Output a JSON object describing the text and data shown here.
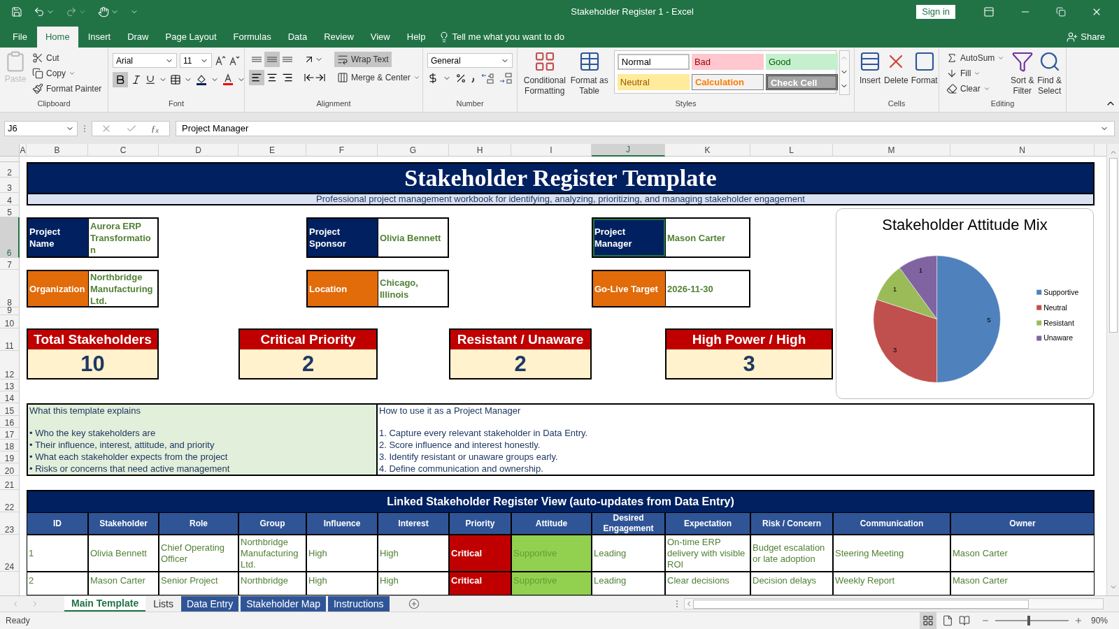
{
  "window": {
    "title": "Stakeholder Register 1  -  Excel",
    "sign_in": "Sign in"
  },
  "menu": {
    "tabs": [
      {
        "label": "File",
        "selected": false
      },
      {
        "label": "Home",
        "selected": true
      },
      {
        "label": "Insert",
        "selected": false
      },
      {
        "label": "Draw",
        "selected": false
      },
      {
        "label": "Page Layout",
        "selected": false
      },
      {
        "label": "Formulas",
        "selected": false
      },
      {
        "label": "Data",
        "selected": false
      },
      {
        "label": "Review",
        "selected": false
      },
      {
        "label": "View",
        "selected": false
      },
      {
        "label": "Help",
        "selected": false
      }
    ],
    "tell_me": "Tell me what you want to do",
    "share": "Share"
  },
  "ribbon": {
    "clipboard": {
      "paste": "Paste",
      "cut": "Cut",
      "copy": "Copy",
      "format_painter": "Format Painter",
      "label": "Clipboard"
    },
    "font": {
      "name": "Arial",
      "size": "11",
      "bold": true,
      "label": "Font"
    },
    "alignment": {
      "vertical_align": [
        {
          "selected": false
        },
        {
          "selected": true
        },
        {
          "selected": false
        }
      ],
      "horizontal_align": [
        {
          "selected": true
        },
        {
          "selected": false
        },
        {
          "selected": false
        }
      ],
      "wrap_text": true,
      "wrap_label": "Wrap Text",
      "merge_label": "Merge & Center",
      "label": "Alignment"
    },
    "number": {
      "format": "General",
      "label": "Number"
    },
    "styles": {
      "conditional": "Conditional Formatting",
      "format_table": "Format as Table",
      "label": "Styles",
      "gallery": [
        {
          "label": "Normal",
          "kind": "normal"
        },
        {
          "label": "Bad",
          "kind": "bad"
        },
        {
          "label": "Good",
          "kind": "good"
        },
        {
          "label": "Neutral",
          "kind": "neutral"
        },
        {
          "label": "Calculation",
          "kind": "calculation"
        },
        {
          "label": "Check Cell",
          "kind": "check"
        }
      ]
    },
    "cells": {
      "insert": "Insert",
      "delete": "Delete",
      "format": "Format",
      "label": "Cells"
    },
    "editing": {
      "autosum": "AutoSum",
      "fill": "Fill",
      "clear": "Clear",
      "sort": "Sort & Filter",
      "find": "Find & Select",
      "label": "Editing"
    }
  },
  "formula_bar": {
    "name_box": "J6",
    "function_label": "ƒ$_{x}$",
    "value": "Project Manager"
  },
  "columns": [
    {
      "label": "A",
      "selected": false
    },
    {
      "label": "B",
      "selected": false
    },
    {
      "label": "C",
      "selected": false
    },
    {
      "label": "D",
      "selected": false
    },
    {
      "label": "E",
      "selected": false
    },
    {
      "label": "F",
      "selected": false
    },
    {
      "label": "G",
      "selected": false
    },
    {
      "label": "H",
      "selected": false
    },
    {
      "label": "I",
      "selected": false
    },
    {
      "label": "J",
      "selected": true
    },
    {
      "label": "K",
      "selected": false
    },
    {
      "label": "L",
      "selected": false
    },
    {
      "label": "M",
      "selected": false
    },
    {
      "label": "N",
      "selected": false
    }
  ],
  "rows": [
    {
      "label": "2",
      "selected": false
    },
    {
      "label": "3",
      "selected": false
    },
    {
      "label": "4",
      "selected": false
    },
    {
      "label": "5",
      "selected": false
    },
    {
      "label": "6",
      "selected": true
    },
    {
      "label": "7",
      "selected": false
    },
    {
      "label": "8",
      "selected": false
    },
    {
      "label": "9",
      "selected": false
    },
    {
      "label": "10",
      "selected": false
    },
    {
      "label": "11",
      "selected": false
    },
    {
      "label": "12",
      "selected": false
    },
    {
      "label": "13",
      "selected": false
    },
    {
      "label": "14",
      "selected": false
    },
    {
      "label": "15",
      "selected": false
    },
    {
      "label": "16",
      "selected": false
    },
    {
      "label": "17",
      "selected": false
    },
    {
      "label": "18",
      "selected": false
    },
    {
      "label": "19",
      "selected": false
    },
    {
      "label": "20",
      "selected": false
    },
    {
      "label": "21",
      "selected": false
    },
    {
      "label": "22",
      "selected": false
    },
    {
      "label": "23",
      "selected": false
    },
    {
      "label": "24",
      "selected": false
    }
  ],
  "sheet": {
    "title": "Stakeholder Register Template",
    "subtitle": "Professional project management workbook for identifying, analyzing, prioritizing, and managing stakeholder engagement",
    "info": [
      {
        "label": "Project Name",
        "value": "Aurora ERP Transformation",
        "color": "#002060",
        "selected": false
      },
      {
        "label": "Project Sponsor",
        "value": "Olivia Bennett",
        "color": "#002060",
        "selected": false
      },
      {
        "label": "Project Manager",
        "value": "Mason Carter",
        "color": "#002060",
        "selected": true
      },
      {
        "label": "Organization",
        "value": "Northbridge Manufacturing Ltd.",
        "color": "#e26b0a",
        "selected": false
      },
      {
        "label": "Location",
        "value": "Chicago, Illinois",
        "color": "#e26b0a",
        "selected": false
      },
      {
        "label": "Go-Live Target",
        "value": "2026-11-30",
        "color": "#e26b0a",
        "selected": false
      }
    ],
    "kpis": [
      {
        "label": "Total Stakeholders",
        "value": "10"
      },
      {
        "label": "Critical Priority",
        "value": "2"
      },
      {
        "label": "Resistant / Unaware",
        "value": "2"
      },
      {
        "label": "High Power / High",
        "value": "3"
      }
    ],
    "explain": {
      "title": "What this template explains",
      "lines": [
        "• Who the key stakeholders are",
        "• Their influence, interest, attitude, and priority",
        "• What each stakeholder expects from the project",
        "• Risks or concerns that need active management"
      ]
    },
    "howto": {
      "title": "How to use it as a Project Manager",
      "lines": [
        "1. Capture every relevant stakeholder in Data Entry.",
        "2. Score influence and interest honestly.",
        "3. Identify resistant or unaware groups early.",
        "4. Define communication and ownership."
      ]
    },
    "register": {
      "title": "Linked Stakeholder Register View (auto-updates from Data Entry)",
      "columns": [
        "ID",
        "Stakeholder",
        "Role",
        "Group",
        "Influence",
        "Interest",
        "Priority",
        "Attitude",
        "Desired Engagement",
        "Expectation",
        "Risk / Concern",
        "Communication",
        "Owner"
      ],
      "rows": [
        {
          "cells": [
            "1",
            "Olivia Bennett",
            "Chief Operating Officer",
            "Northbridge Manufacturing Ltd.",
            "High",
            "High",
            {
              "text": "Critical",
              "color": "#c00000"
            },
            {
              "text": "Supportive",
              "color": "#92d050"
            },
            "Leading",
            "On-time ERP delivery with visible ROI",
            "Budget escalation or late adoption",
            "Steering Meeting",
            "Mason Carter"
          ]
        },
        {
          "cells": [
            "2",
            "Mason Carter",
            "Senior Project",
            "Northbridge",
            "High",
            "High",
            {
              "text": "Critical",
              "color": "#c00000"
            },
            {
              "text": "Supportive",
              "color": "#92d050"
            },
            "Leading",
            "Clear decisions",
            "Decision delays",
            "Weekly Report",
            "Mason Carter"
          ]
        }
      ]
    }
  },
  "chart": {
    "chart_data": {
      "type": "pie",
      "title": "Stakeholder Attitude Mix",
      "categories": [
        "Supportive",
        "Neutral",
        "Resistant",
        "Unaware"
      ],
      "values": [
        5,
        3,
        1,
        1
      ],
      "data_labels": true,
      "legend": "right"
    }
  },
  "sheet_tabs": [
    {
      "label": "Main Template",
      "selected": true
    },
    {
      "label": "Lists",
      "selected": false
    },
    {
      "label": "Data Entry",
      "selected": false,
      "color": "#2f5597"
    },
    {
      "label": "Stakeholder Map",
      "selected": false,
      "color": "#2f5597"
    },
    {
      "label": "Instructions",
      "selected": false,
      "color": "#2f5597"
    }
  ],
  "status_bar": {
    "text": "Ready",
    "zoom": "90%",
    "zoom_slider": {
      "level": 0.46
    }
  }
}
